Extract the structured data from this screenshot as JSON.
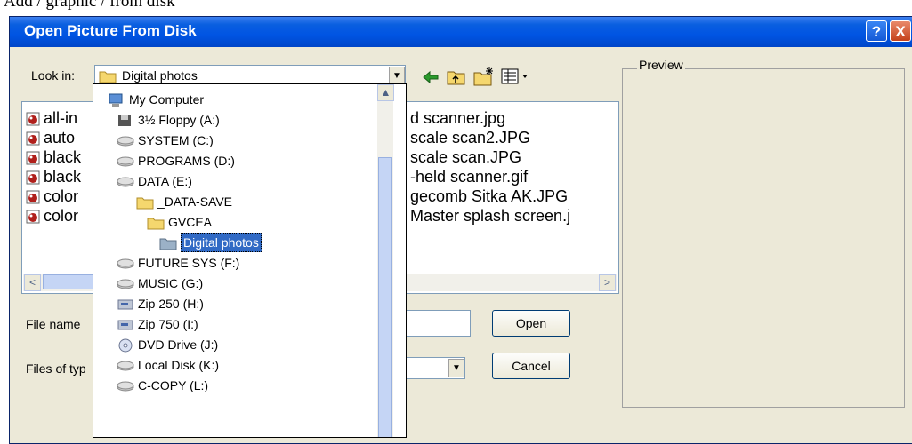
{
  "document": {
    "caption": "Add / graphic / from disk"
  },
  "dialog": {
    "title": "Open Picture From Disk",
    "help_label": "?",
    "close_label": "X"
  },
  "look_in": {
    "label": "Look in:",
    "value": "Digital photos"
  },
  "toolbar": {
    "back_icon": "back-arrow-icon",
    "up_icon": "up-folder-icon",
    "new_folder_icon": "new-folder-icon",
    "views_icon": "views-menu-icon"
  },
  "file_list": {
    "rows": [
      {
        "left": "all-in",
        "right": "d scanner.jpg"
      },
      {
        "left": "auto",
        "right": "scale scan2.JPG"
      },
      {
        "left": "black",
        "right": "scale scan.JPG"
      },
      {
        "left": "black",
        "right": "-held scanner.gif"
      },
      {
        "left": "color",
        "right": "gecomb Sitka AK.JPG"
      },
      {
        "left": "color",
        "right": "Master splash screen.j"
      }
    ],
    "left_arrow": "<",
    "right_arrow": ">"
  },
  "preview": {
    "label": "Preview"
  },
  "file_name": {
    "label": "File name",
    "value": ""
  },
  "files_of_type": {
    "label": "Files of typ",
    "value": ""
  },
  "buttons": {
    "open": "Open",
    "cancel": "Cancel"
  },
  "dropdown": {
    "items": [
      {
        "label": "My Computer",
        "icon": "computer-icon"
      },
      {
        "label": "3½ Floppy (A:)",
        "icon": "floppy-icon"
      },
      {
        "label": "SYSTEM (C:)",
        "icon": "drive-icon"
      },
      {
        "label": "PROGRAMS (D:)",
        "icon": "drive-icon"
      },
      {
        "label": "DATA (E:)",
        "icon": "drive-icon"
      },
      {
        "label": "_DATA-SAVE",
        "icon": "folder-icon"
      },
      {
        "label": "GVCEA",
        "icon": "folder-icon"
      },
      {
        "label": "Digital photos",
        "icon": "open-folder-icon",
        "selected": true
      },
      {
        "label": "FUTURE SYS (F:)",
        "icon": "drive-icon"
      },
      {
        "label": "MUSIC (G:)",
        "icon": "drive-icon"
      },
      {
        "label": "Zip 250 (H:)",
        "icon": "zip-drive-icon"
      },
      {
        "label": "Zip 750  (I:)",
        "icon": "zip-drive-icon"
      },
      {
        "label": "DVD Drive (J:)",
        "icon": "dvd-drive-icon"
      },
      {
        "label": "Local Disk (K:)",
        "icon": "drive-icon"
      },
      {
        "label": "C-COPY (L:)",
        "icon": "drive-icon"
      }
    ]
  },
  "colors": {
    "title_bar": "#0054e3",
    "dialog_face": "#ece9d8",
    "selection": "#316ac5"
  }
}
